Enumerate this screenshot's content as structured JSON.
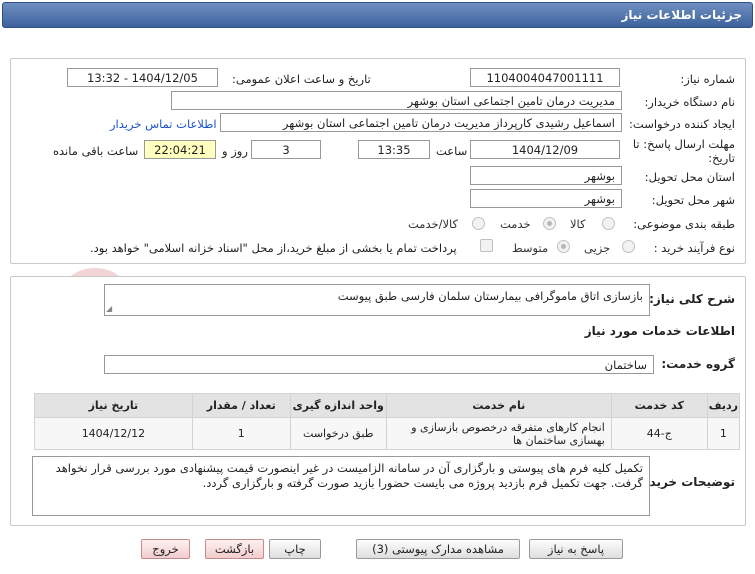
{
  "window": {
    "title": "جزئیات اطلاعات نیاز"
  },
  "labels": {
    "need_number": "شماره نیاز:",
    "announce_datetime": "تاریخ و ساعت اعلان عمومی:",
    "buyer_org": "نام دستگاه خریدار:",
    "requester": "ایجاد کننده درخواست:",
    "deadline": "مهلت ارسال پاسخ: تا تاریخ:",
    "time_word": "ساعت",
    "day_and": "روز و",
    "remaining": "ساعت باقی مانده",
    "province": "استان محل تحویل:",
    "city": "شهر محل تحویل:",
    "category": "طبقه بندی موضوعی:",
    "process_type": "نوع فرآیند خرید :",
    "general_desc": "شرح کلی نیاز:",
    "services_info": "اطلاعات خدمات مورد نیاز",
    "service_group": "گروه خدمت:",
    "buyer_notes": "توضیحات خریدار:"
  },
  "fields": {
    "need_number": "1104004047001111",
    "announce_datetime": "1404/12/05 - 13:32",
    "buyer_org": "مدیریت درمان تامین اجتماعی استان بوشهر",
    "requester": "اسماعیل رشیدی کارپرداز مدیریت درمان تامین اجتماعی استان بوشهر",
    "deadline_date": "1404/12/09",
    "deadline_time": "13:35",
    "days_left": "3",
    "time_left": "22:04:21",
    "province": "بوشهر",
    "city": "بوشهر",
    "general_desc": "بازسازی اتاق ماموگرافی بیمارستان سلمان فارسی طبق پیوست",
    "service_group": "ساختمان",
    "buyer_notes": "تکمیل کلیه فرم های پیوستی و بارگزاری آن در سامانه الزامیست در غیر اینصورت قیمت پیشنهادی مورد بررسی قرار نخواهد گرفت. جهت تکمیل فرم بازدید پروژه می بایست حضورا بازید صورت گرفته و بارگزاری گردد."
  },
  "links": {
    "contact_buyer": "اطلاعات تماس خریدار"
  },
  "category_options": {
    "goods": "کالا",
    "service": "خدمت",
    "goods_service": "کالا/خدمت",
    "selected": "خدمت"
  },
  "process_options": {
    "partial": "جزیی",
    "medium": "متوسط",
    "selected": "متوسط",
    "treasury_note": "پرداخت تمام یا بخشی از مبلغ خرید،از محل \"اسناد خزانه اسلامی\" خواهد بود."
  },
  "table": {
    "headers": [
      "ردیف",
      "کد خدمت",
      "نام خدمت",
      "واحد اندازه گیری",
      "تعداد / مقدار",
      "تاریخ نیاز"
    ],
    "rows": [
      [
        "1",
        "ج-44",
        "انجام کارهای متفرقه درخصوص بازسازی و بهسازی ساختمان ها",
        "طبق درخواست",
        "1",
        "1404/12/12"
      ]
    ]
  },
  "buttons": {
    "reply": "پاسخ به نیاز",
    "view_docs": "مشاهده مدارک پیوستی (3)",
    "print": "چاپ",
    "back": "بازگشت",
    "exit": "خروج"
  },
  "watermark": {
    "text": "AriaTender.net"
  },
  "colors": {
    "title_bar": "#4a6ea8",
    "link": "#1a54c8",
    "timer_bg": "#ffffc0"
  }
}
